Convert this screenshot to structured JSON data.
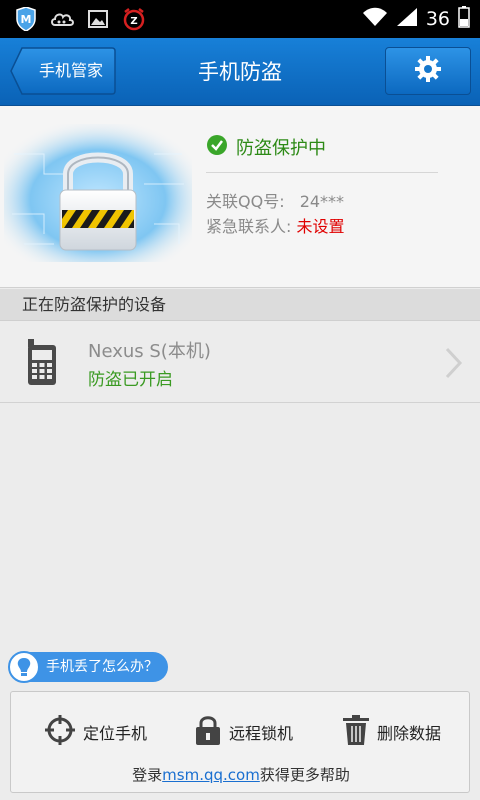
{
  "status_bar": {
    "left_icons": [
      "msm-shield-icon",
      "cloud-icon",
      "image-icon",
      "alarm-icon"
    ],
    "battery_level_text": "36",
    "icons": [
      "wifi-icon",
      "signal-icon",
      "battery-icon"
    ]
  },
  "header": {
    "back_label": "手机管家",
    "title": "手机防盗",
    "settings_icon": "gear-icon"
  },
  "hero": {
    "status": "防盗保护中",
    "qq_label": "关联QQ号:",
    "qq_value": "24***",
    "contact_label": "紧急联系人:",
    "contact_value": "未设置",
    "colors": {
      "ok": "#2d8a16",
      "warn": "#e00000"
    }
  },
  "section": {
    "title": "正在防盗保护的设备"
  },
  "device": {
    "name": "Nexus S(本机)",
    "status": "防盗已开启"
  },
  "help": {
    "label": "手机丢了怎么办？"
  },
  "actions": [
    {
      "label": "定位手机",
      "icon": "locate-icon"
    },
    {
      "label": "远程锁机",
      "icon": "lock-icon"
    },
    {
      "label": "删除数据",
      "icon": "trash-icon"
    }
  ],
  "footer": {
    "prefix": "登录",
    "link": "msm.qq.com",
    "suffix": "获得更多帮助"
  },
  "theme": {
    "accent": "#0a62b6",
    "link": "#1a6fd0"
  }
}
